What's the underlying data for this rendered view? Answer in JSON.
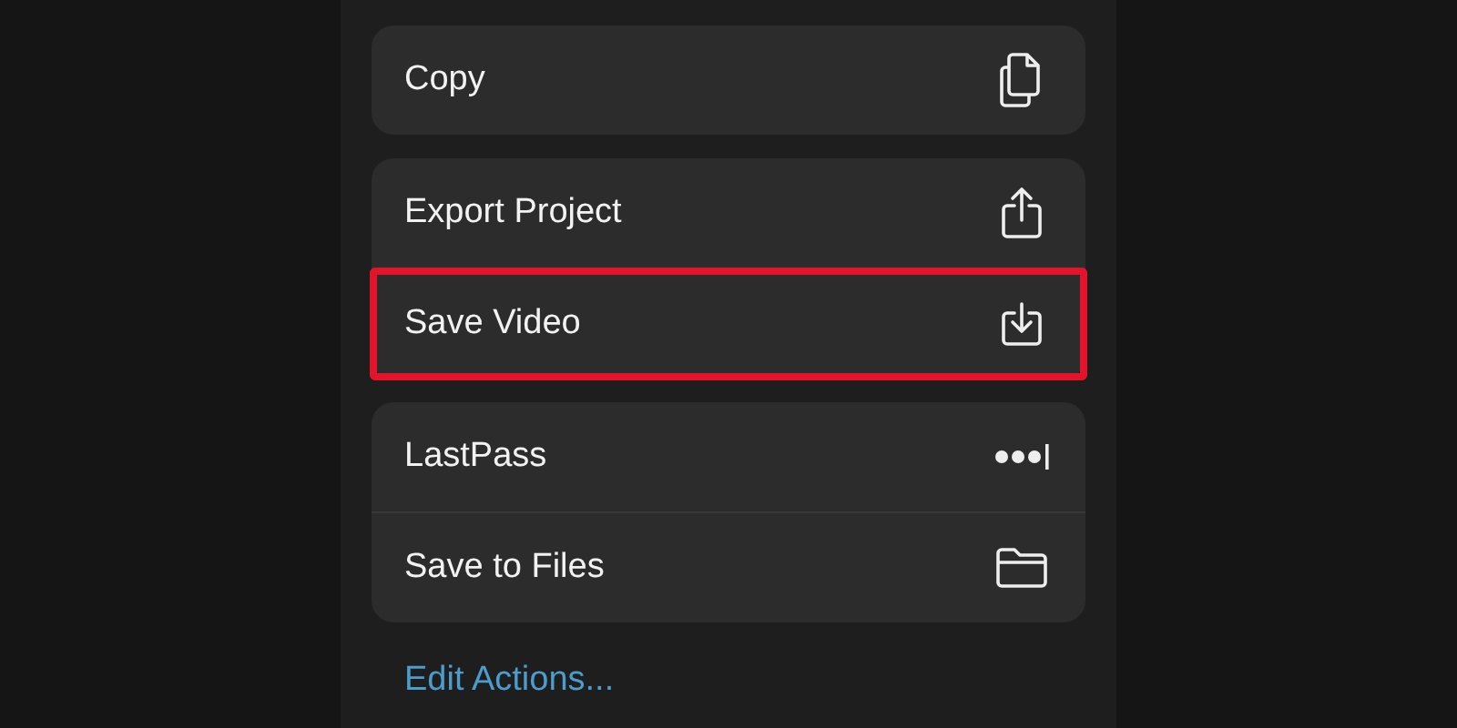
{
  "groups": [
    {
      "items": [
        {
          "label": "Copy",
          "kind": "copy",
          "highlighted": false
        }
      ]
    },
    {
      "items": [
        {
          "label": "Export Project",
          "kind": "share",
          "highlighted": false
        },
        {
          "label": "Save Video",
          "kind": "download",
          "highlighted": true
        }
      ]
    },
    {
      "items": [
        {
          "label": "LastPass",
          "kind": "dots",
          "highlighted": false
        },
        {
          "label": "Save to Files",
          "kind": "folder",
          "highlighted": false
        }
      ]
    }
  ],
  "link": "Edit Actions..."
}
